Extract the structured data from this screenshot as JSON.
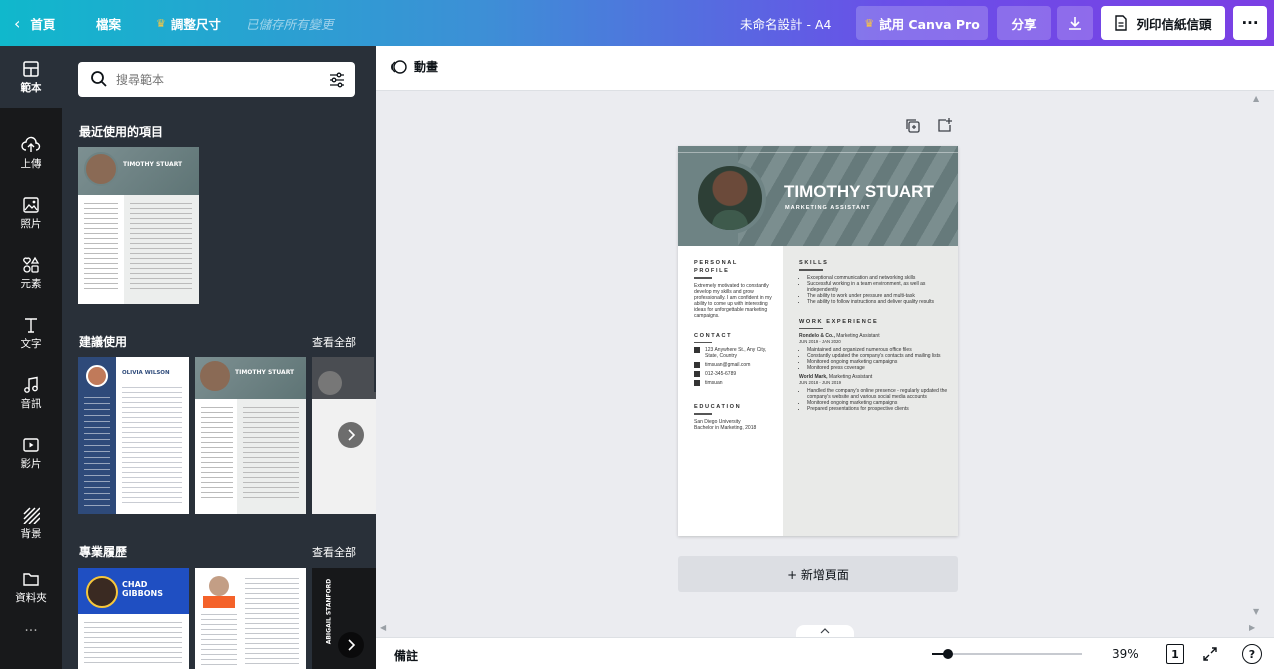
{
  "topbar": {
    "home": "首頁",
    "file": "檔案",
    "resize": "調整尺寸",
    "save_status": "已儲存所有變更",
    "doc_title": "未命名設計 - A4",
    "try_pro": "試用 Canva Pro",
    "share": "分享",
    "print": "列印信紙信頭",
    "more": "···"
  },
  "rail": {
    "items": [
      {
        "label": "範本",
        "icon": "template-icon"
      },
      {
        "label": "上傳",
        "icon": "upload-icon"
      },
      {
        "label": "照片",
        "icon": "photo-icon"
      },
      {
        "label": "元素",
        "icon": "elements-icon"
      },
      {
        "label": "文字",
        "icon": "text-icon"
      },
      {
        "label": "音訊",
        "icon": "music-icon"
      },
      {
        "label": "影片",
        "icon": "video-icon"
      },
      {
        "label": "背景",
        "icon": "background-icon"
      },
      {
        "label": "資料夾",
        "icon": "folder-icon"
      }
    ],
    "more": "···"
  },
  "panel": {
    "search_placeholder": "搜尋範本",
    "recent_title": "最近使用的項目",
    "suggested_title": "建議使用",
    "suggested_see_all": "查看全部",
    "pro_title": "專業履歷",
    "pro_see_all": "查看全部"
  },
  "thumbs": {
    "recent_name": "TIMOTHY STUART",
    "olivia_name": "OLIVIA WILSON",
    "timothy_name": "TIMOTHY STUART",
    "chad_first": "CHAD",
    "chad_last": "GIBBONS",
    "abigail": "ABIGAIL STANFORD"
  },
  "toolbar": {
    "animate": "動畫"
  },
  "resume": {
    "name": "TIMOTHY STUART",
    "role": "MARKETING ASSISTANT",
    "profile_heading_1": "PERSONAL",
    "profile_heading_2": "PROFILE",
    "profile_text": "Extremely motivated to constantly develop my skills and grow professionally. I am confident in my ability to come up with interesting ideas for unforgettable marketing campaigns.",
    "contact_heading": "CONTACT",
    "address": "123 Anywhere St., Any City, State, Country",
    "email": "timsuan@gmail.com",
    "phone": "012-345-6789",
    "linkedin": "timsuan",
    "education_heading": "EDUCATION",
    "school": "San Diego University",
    "degree": "Bachelor in Marketing, 2018",
    "skills_heading": "SKILLS",
    "skills": [
      "Exceptional communication and networking skills",
      "Successful working in a team environment, as well as independently",
      "The ability to work under pressure and multi-task",
      "The ability to follow instructions and deliver quality results"
    ],
    "work_heading": "WORK EXPERIENCE",
    "jobs": [
      {
        "company": "Rondelo & Co.,",
        "title": "Marketing Assistant",
        "dates": "JUN 2019 - JAN 2020",
        "bullets": [
          "Maintained and organized numerous office files",
          "Constantly updated the company's contacts and mailing lists",
          "Monitored ongoing marketing campaigns",
          "Monitored press coverage"
        ]
      },
      {
        "company": "World Mark,",
        "title": "Marketing Assistant",
        "dates": "JUN 2018 - JUN 2019",
        "bullets": [
          "Handled the company's online presence - regularly updated the company's website and various social media accounts",
          "Monitored ongoing marketing campaigns",
          "Prepared presentations for prospective clients"
        ]
      }
    ]
  },
  "canvas": {
    "add_page": "+ 新增頁面"
  },
  "footer": {
    "notes": "備註",
    "zoom": "39%",
    "page_count": "1",
    "zoom_level": 0.39,
    "help": "?"
  },
  "colors": {
    "accent": "#7d2ae8",
    "panel": "#293039",
    "rail": "#18191b",
    "resume_band": "#6e8384"
  }
}
